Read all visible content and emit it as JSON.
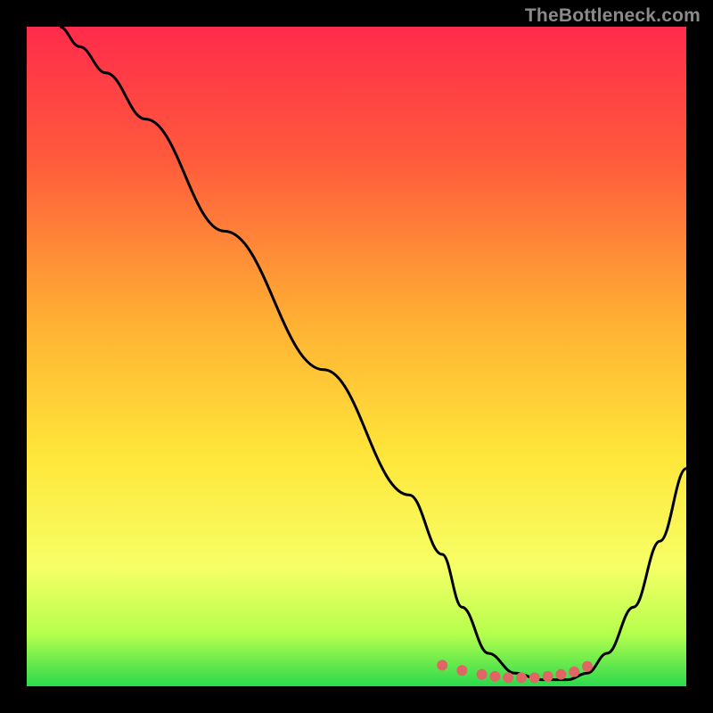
{
  "watermark": "TheBottleneck.com",
  "chart_data": {
    "type": "line",
    "title": "",
    "xlabel": "",
    "ylabel": "",
    "xlim": [
      0,
      100
    ],
    "ylim": [
      0,
      100
    ],
    "gradient_stops": [
      {
        "offset": 0,
        "color": "#ff2b4c"
      },
      {
        "offset": 20,
        "color": "#ff5a3c"
      },
      {
        "offset": 45,
        "color": "#ffb133"
      },
      {
        "offset": 65,
        "color": "#ffe63a"
      },
      {
        "offset": 82,
        "color": "#f6ff66"
      },
      {
        "offset": 92,
        "color": "#b6ff4d"
      },
      {
        "offset": 100,
        "color": "#2bd94d"
      }
    ],
    "series": [
      {
        "name": "bottleneck-curve",
        "stroke": "#000000",
        "x": [
          5,
          8,
          12,
          18,
          30,
          45,
          58,
          63,
          66,
          70,
          74,
          78,
          82,
          85,
          88,
          92,
          96,
          100
        ],
        "y": [
          100,
          97,
          93,
          86,
          69,
          48,
          29,
          20,
          12,
          5,
          2,
          1,
          1,
          2,
          5,
          12,
          22,
          33
        ]
      }
    ],
    "markers": {
      "name": "trough-dots",
      "fill": "#e06666",
      "r": 6,
      "points": [
        {
          "x": 63,
          "y": 3.2
        },
        {
          "x": 66,
          "y": 2.4
        },
        {
          "x": 69,
          "y": 1.8
        },
        {
          "x": 71,
          "y": 1.5
        },
        {
          "x": 73,
          "y": 1.3
        },
        {
          "x": 75,
          "y": 1.3
        },
        {
          "x": 77,
          "y": 1.3
        },
        {
          "x": 79,
          "y": 1.5
        },
        {
          "x": 81,
          "y": 1.8
        },
        {
          "x": 83,
          "y": 2.2
        },
        {
          "x": 85,
          "y": 3.0
        }
      ]
    }
  }
}
